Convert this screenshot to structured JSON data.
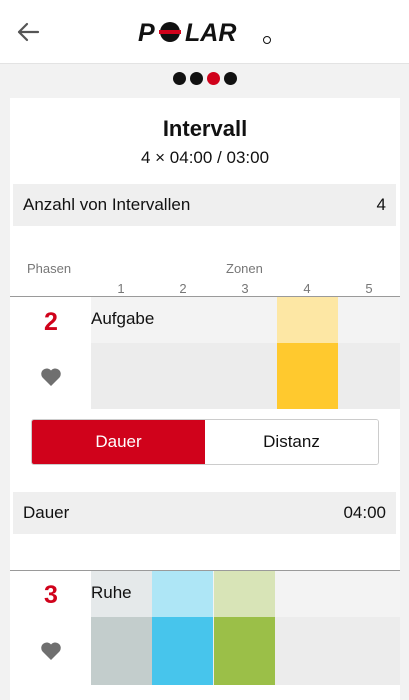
{
  "header": {
    "back_icon": "arrow-left-icon",
    "logo_text": "POLAR"
  },
  "pager": {
    "total": 4,
    "active_index": 2
  },
  "workout": {
    "title": "Intervall",
    "subtitle": "4 × 04:00 / 03:00",
    "interval_count_label": "Anzahl von Intervallen",
    "interval_count_value": "4"
  },
  "table": {
    "phases_label": "Phasen",
    "zones_label": "Zonen",
    "zones": [
      "1",
      "2",
      "3",
      "4",
      "5"
    ]
  },
  "phases": [
    {
      "number": "2",
      "label": "Aufgabe",
      "icon": "heart-icon"
    },
    {
      "number": "3",
      "label": "Ruhe",
      "icon": "heart-icon"
    }
  ],
  "mode_toggle": {
    "duration_label": "Dauer",
    "distance_label": "Distanz",
    "selected": "Dauer"
  },
  "duration": {
    "label": "Dauer",
    "value": "04:00"
  },
  "colors": {
    "accent": "#d0021b",
    "zone4_light": "#fde7a4",
    "zone4": "#ffc92e",
    "zone1_light": "#e5e9ea",
    "zone1": "#c3cdcc",
    "zone2_light": "#aee6f6",
    "zone2": "#47c5ec",
    "zone3_light": "#d8e4b7",
    "zone3": "#9bbf48"
  }
}
